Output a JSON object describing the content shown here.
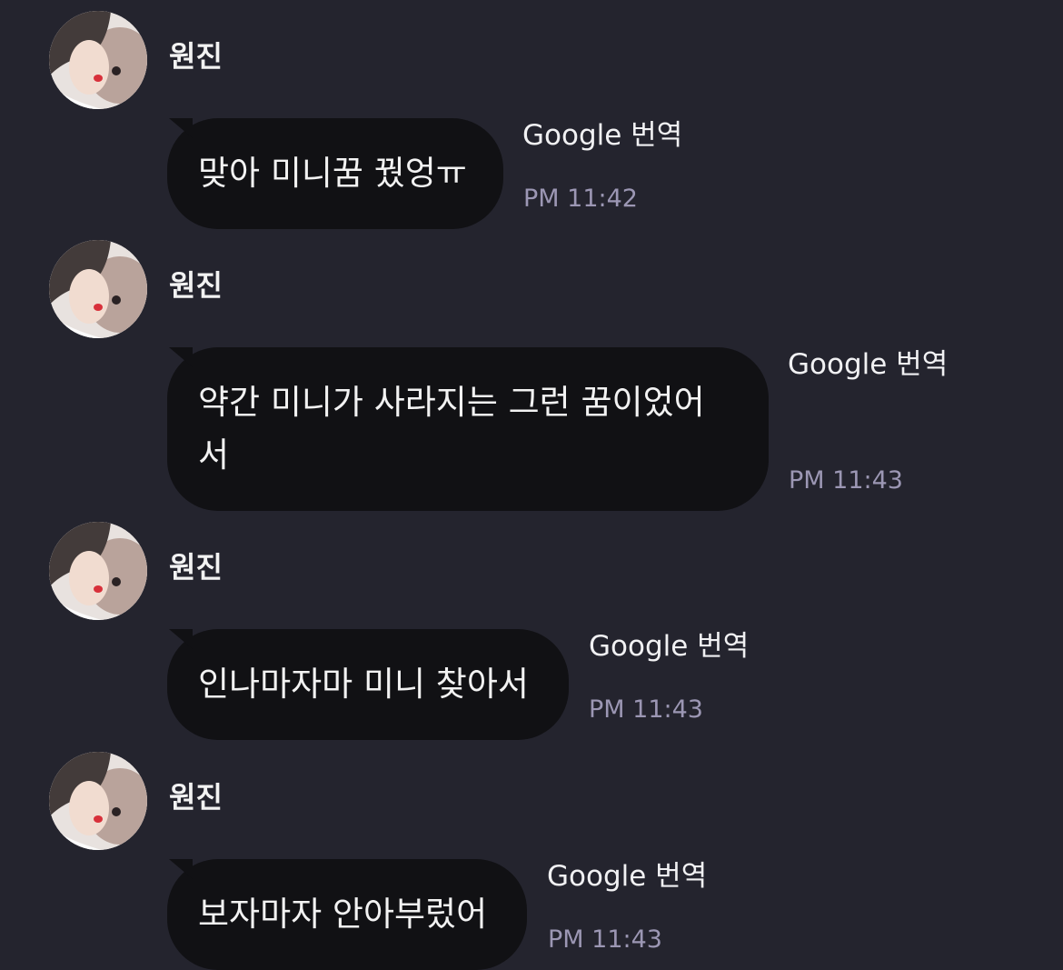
{
  "messages": [
    {
      "sender": "원진",
      "text": "맞아 미니꿈 꿨엉ㅠ",
      "translate_label": "Google 번역",
      "time": "PM 11:42"
    },
    {
      "sender": "원진",
      "text": "약간 미니가 사라지는 그런 꿈이었어\n서",
      "translate_label": "Google 번역",
      "time": "PM 11:43"
    },
    {
      "sender": "원진",
      "text": "인나마자마 미니 찾아서",
      "translate_label": "Google 번역",
      "time": "PM 11:43"
    },
    {
      "sender": "원진",
      "text": "보자마자 안아부렀어",
      "translate_label": "Google 번역",
      "time": "PM 11:43"
    }
  ],
  "colors": {
    "background": "#24242e",
    "bubble": "#111114",
    "text": "#f2f2f2",
    "time": "#9c97b4"
  }
}
